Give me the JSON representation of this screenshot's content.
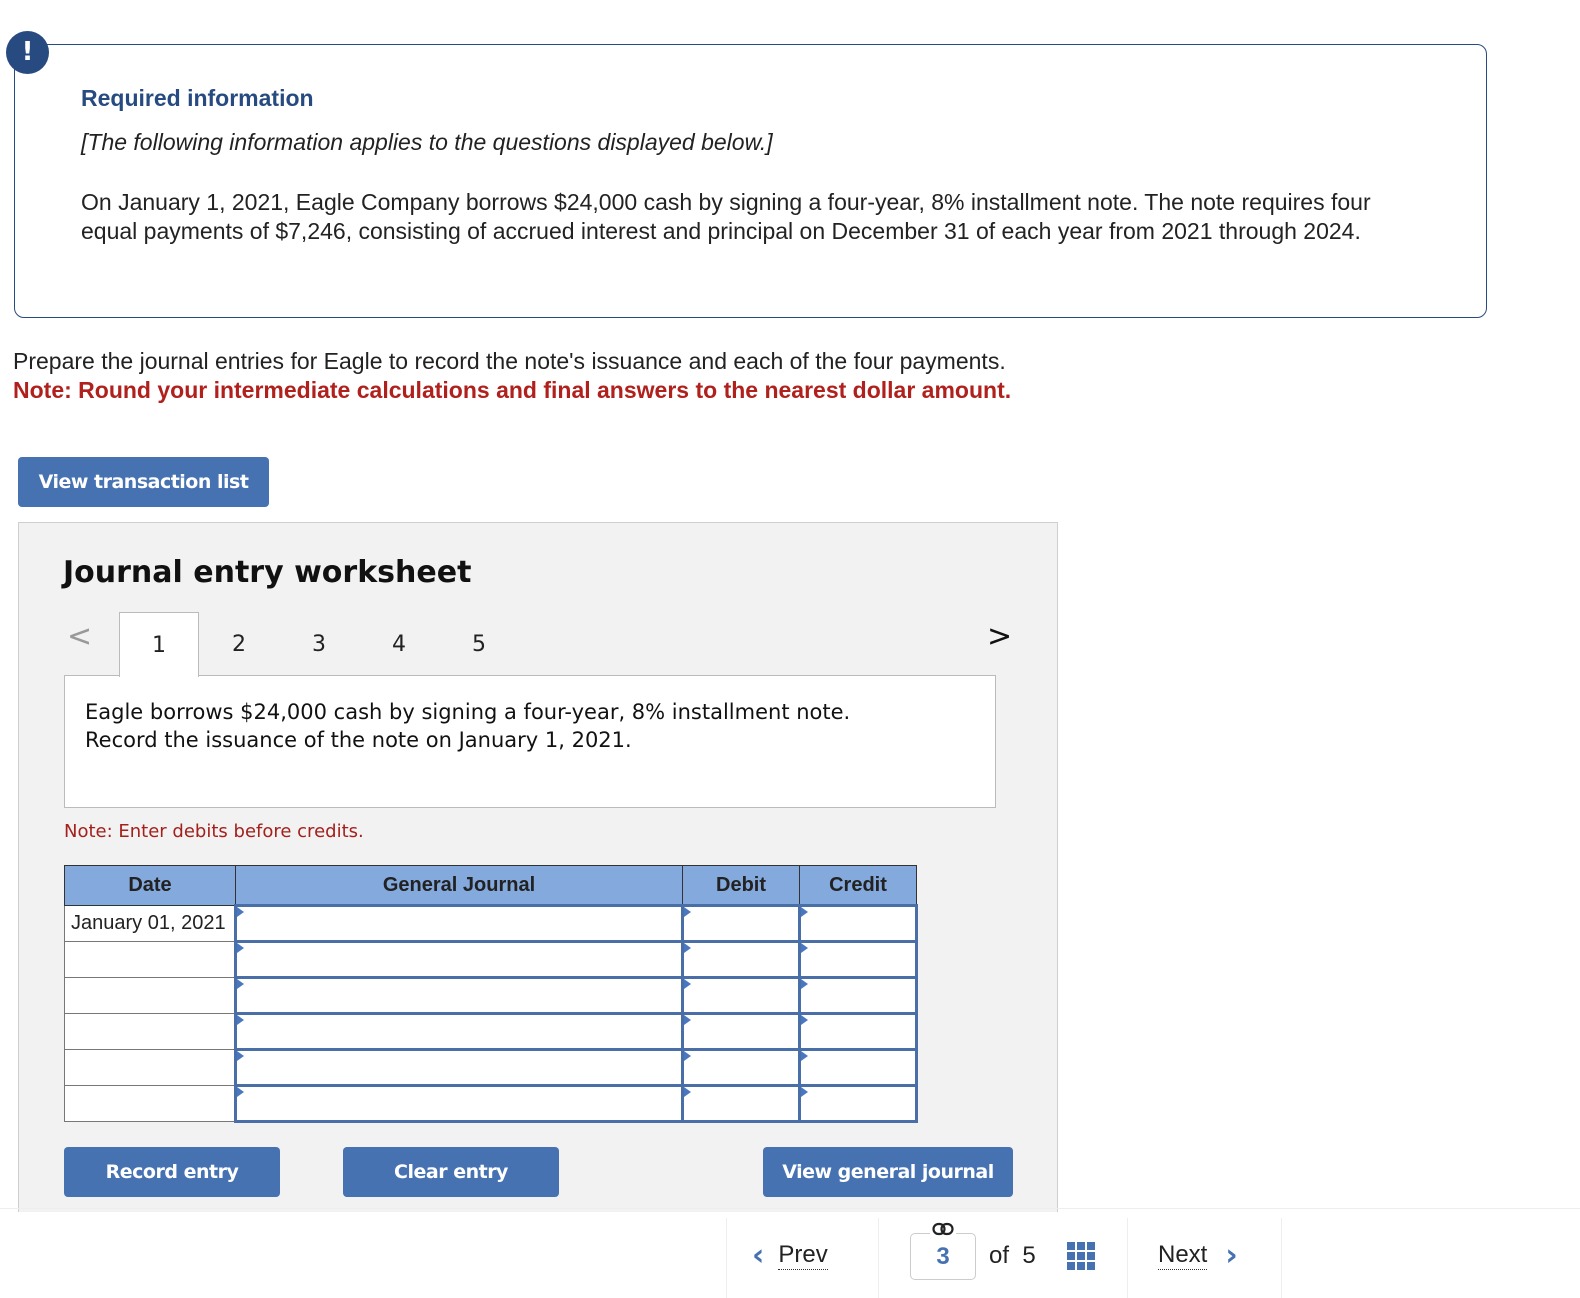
{
  "required_info": {
    "badge": "!",
    "title": "Required information",
    "subtitle": "[The following information applies to the questions displayed below.]",
    "body": "On January 1, 2021, Eagle Company borrows $24,000 cash by signing a four-year, 8% installment note. The note requires four equal payments of $7,246, consisting of accrued interest and principal on December 31 of each year from 2021 through 2024."
  },
  "prompt": {
    "text": "Prepare the journal entries for Eagle to record the note's issuance and each of the four payments.",
    "note": "Note: Round your intermediate calculations and final answers to the nearest dollar amount."
  },
  "buttons": {
    "view_transaction_list": "View transaction list",
    "record_entry": "Record entry",
    "clear_entry": "Clear entry",
    "view_general_journal": "View general journal"
  },
  "worksheet": {
    "title": "Journal entry worksheet",
    "prev_icon": "<",
    "next_icon": ">",
    "tabs": [
      "1",
      "2",
      "3",
      "4",
      "5"
    ],
    "active_tab": "1",
    "description_line1": "Eagle borrows $24,000 cash by signing a four-year, 8% installment note.",
    "description_line2": "Record the issuance of the note on January 1, 2021.",
    "note": "Note: Enter debits before credits.",
    "table": {
      "headers": [
        "Date",
        "General Journal",
        "Debit",
        "Credit"
      ],
      "rows": [
        {
          "date": "January 01, 2021",
          "account": "",
          "debit": "",
          "credit": ""
        },
        {
          "date": "",
          "account": "",
          "debit": "",
          "credit": ""
        },
        {
          "date": "",
          "account": "",
          "debit": "",
          "credit": ""
        },
        {
          "date": "",
          "account": "",
          "debit": "",
          "credit": ""
        },
        {
          "date": "",
          "account": "",
          "debit": "",
          "credit": ""
        },
        {
          "date": "",
          "account": "",
          "debit": "",
          "credit": ""
        }
      ]
    }
  },
  "pagination": {
    "prev_label": "Prev",
    "next_label": "Next",
    "prev_icon": "‹",
    "next_icon": "›",
    "link_icon": "🔗",
    "current_page": "3",
    "of_text": "of",
    "total_pages": "5"
  },
  "colors": {
    "accent": "#4672b2",
    "dark_blue": "#274b80",
    "note_red": "#b0211d",
    "table_header": "#84a9dd"
  }
}
